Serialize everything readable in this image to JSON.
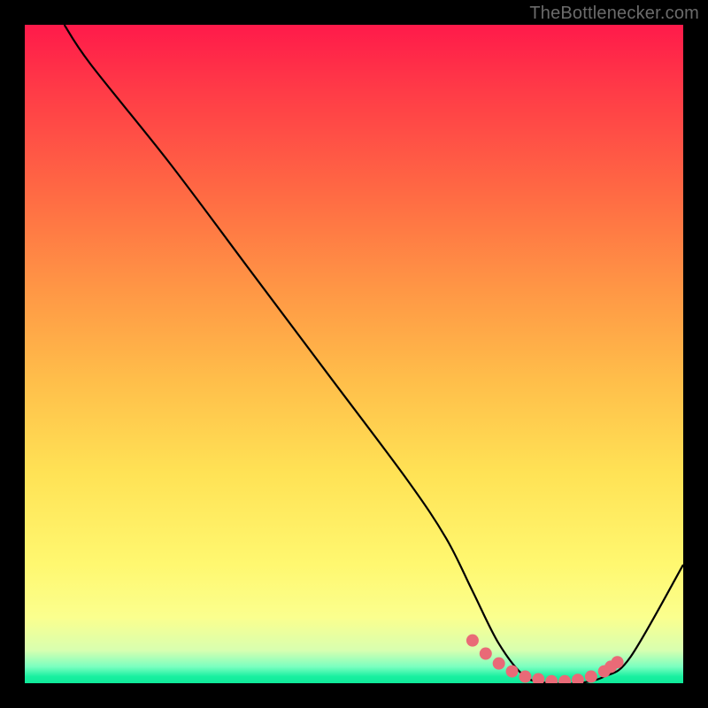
{
  "attribution": "TheBottlenecker.com",
  "chart_data": {
    "type": "line",
    "title": "",
    "xlabel": "",
    "ylabel": "",
    "xlim": [
      0,
      100
    ],
    "ylim": [
      0,
      100
    ],
    "series": [
      {
        "name": "bottleneck-curve",
        "x": [
          6,
          10,
          22,
          34,
          46,
          58,
          64,
          68,
          72,
          76,
          80,
          84,
          88,
          92,
          100
        ],
        "values": [
          100,
          94,
          79,
          63,
          47,
          31,
          22,
          14,
          6,
          1,
          0,
          0,
          1,
          4,
          18
        ]
      }
    ],
    "markers": {
      "name": "optimal-range-dots",
      "x": [
        68,
        70,
        72,
        74,
        76,
        78,
        80,
        82,
        84,
        86,
        88,
        89,
        90
      ],
      "values": [
        6.5,
        4.5,
        3.0,
        1.8,
        1.0,
        0.6,
        0.3,
        0.3,
        0.5,
        1.0,
        1.8,
        2.5,
        3.2
      ]
    },
    "gradient_stops": [
      {
        "pct": 0,
        "color": "#ff1a4a"
      },
      {
        "pct": 10,
        "color": "#ff3b47"
      },
      {
        "pct": 25,
        "color": "#ff6844"
      },
      {
        "pct": 40,
        "color": "#ff9645"
      },
      {
        "pct": 54,
        "color": "#ffbe4a"
      },
      {
        "pct": 68,
        "color": "#ffe255"
      },
      {
        "pct": 82,
        "color": "#fff870"
      },
      {
        "pct": 90,
        "color": "#fbff8e"
      },
      {
        "pct": 95,
        "color": "#d8ffb0"
      },
      {
        "pct": 97.5,
        "color": "#7affc0"
      },
      {
        "pct": 99,
        "color": "#18f0a0"
      },
      {
        "pct": 100,
        "color": "#10e89a"
      }
    ],
    "curve_color": "#000000",
    "marker_color": "#e96a77",
    "marker_radius": 7
  }
}
